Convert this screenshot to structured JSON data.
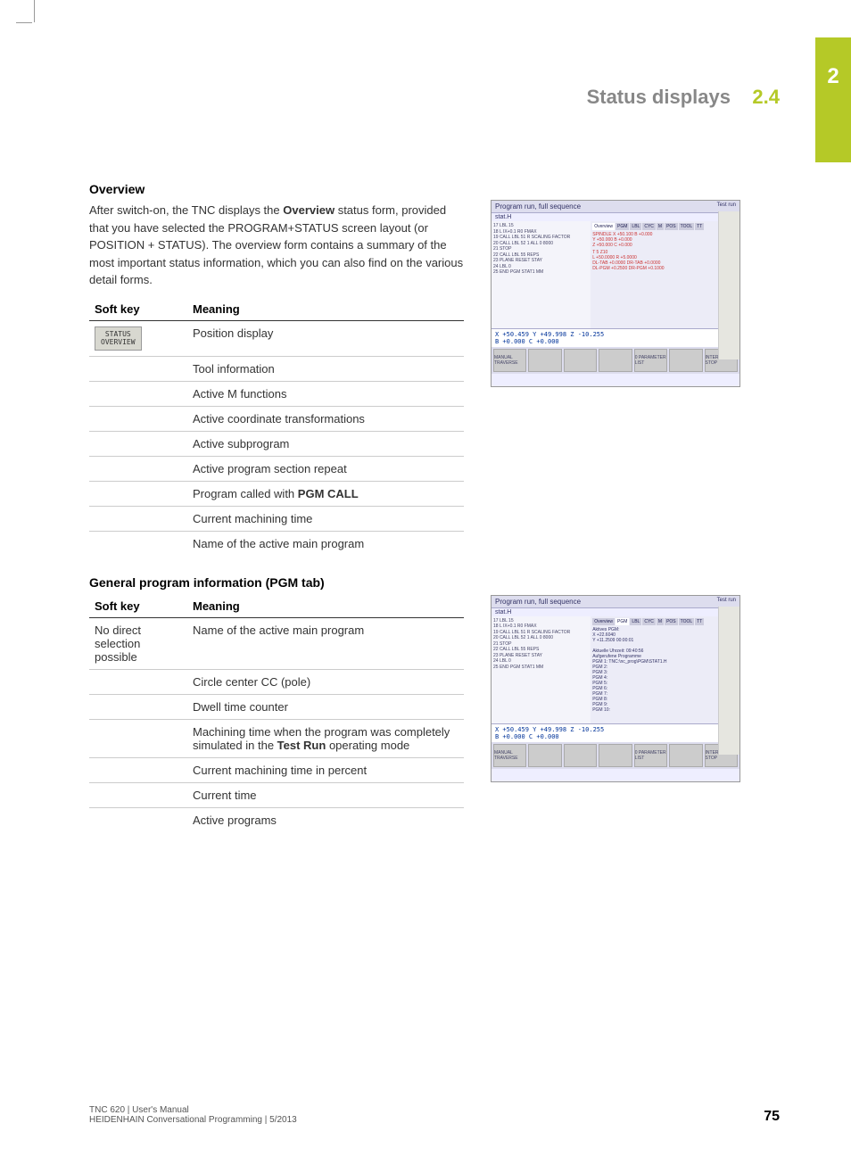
{
  "chapter_tab": "2",
  "header": {
    "title": "Status displays",
    "number": "2.4"
  },
  "section1": {
    "heading": "Overview",
    "paragraph_parts": [
      "After switch-on, the TNC displays the ",
      "Overview",
      " status form, provided that you have selected the PROGRAM+STATUS screen layout (or POSITION + STATUS). The overview form contains a summary of the most important status information, which you can also find on the various detail forms."
    ]
  },
  "table1": {
    "col1": "Soft key",
    "col2": "Meaning",
    "rows": [
      {
        "softkey": "STATUS\nOVERVIEW",
        "meaning": "Position display"
      },
      {
        "softkey": "",
        "meaning": "Tool information"
      },
      {
        "softkey": "",
        "meaning": "Active M functions"
      },
      {
        "softkey": "",
        "meaning": "Active coordinate transformations"
      },
      {
        "softkey": "",
        "meaning": "Active subprogram"
      },
      {
        "softkey": "",
        "meaning": "Active program section repeat"
      },
      {
        "softkey": "",
        "meaning_parts": [
          "Program called with ",
          "PGM CALL"
        ]
      },
      {
        "softkey": "",
        "meaning": "Current machining time"
      },
      {
        "softkey": "",
        "meaning": "Name of the active main program"
      }
    ]
  },
  "section2": {
    "heading": "General program information (PGM tab)"
  },
  "table2": {
    "col1": "Soft key",
    "col2": "Meaning",
    "rows": [
      {
        "softkey_text": "No direct selection possible",
        "meaning": "Name of the active main program"
      },
      {
        "softkey_text": "",
        "meaning": "Circle center CC (pole)"
      },
      {
        "softkey_text": "",
        "meaning": "Dwell time counter"
      },
      {
        "softkey_text": "",
        "meaning_parts": [
          "Machining time when the program was completely simulated in the ",
          "Test Run",
          " operating mode"
        ]
      },
      {
        "softkey_text": "",
        "meaning": "Current machining time in percent"
      },
      {
        "softkey_text": "",
        "meaning": "Current time"
      },
      {
        "softkey_text": "",
        "meaning": "Active programs"
      }
    ]
  },
  "screenshot": {
    "title": "Program run, full sequence",
    "mode_label": "Test run",
    "subtitle": "stat.H",
    "tabs": [
      "Overview",
      "PGM",
      "LBL",
      "CYC",
      "M",
      "POS",
      "TOOL",
      "TT"
    ],
    "pos_line1": "X   +50.459  Y   +49.998  Z   -10.255",
    "pos_line2": "B    +0.000  C    +0.000",
    "btn1": "MANUAL TRAVERSE",
    "btn2": "0 PARAMETER LIST",
    "btn3": "INTERNAL STOP"
  },
  "footer": {
    "line1": "TNC 620 | User's Manual",
    "line2": "HEIDENHAIN Conversational Programming | 5/2013",
    "page": "75"
  }
}
